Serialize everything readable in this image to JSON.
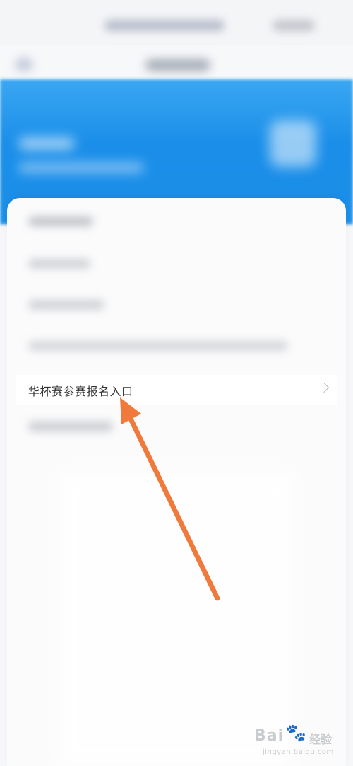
{
  "entry": {
    "label": "华杯赛参赛报名入口"
  },
  "watermark": {
    "logo": "Bai",
    "paw": "🐾",
    "cn": "经验",
    "url": "jingyan.baidu.com"
  },
  "colors": {
    "accent_blue": "#1a8ee9",
    "arrow": "#f07a3c",
    "text": "#333333"
  },
  "icons": {
    "row_chevron": "chevron-right-icon",
    "header_icon": "home-icon"
  }
}
